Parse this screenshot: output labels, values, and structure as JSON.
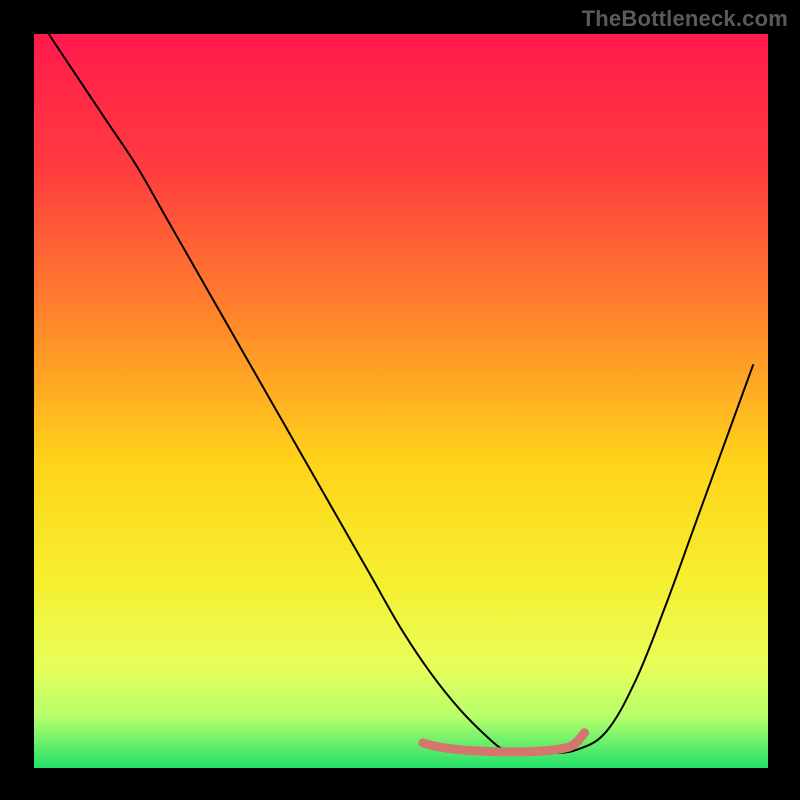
{
  "watermark": "TheBottleneck.com",
  "chart_data": {
    "type": "line",
    "title": "",
    "xlabel": "",
    "ylabel": "",
    "xlim": [
      0,
      100
    ],
    "ylim": [
      0,
      100
    ],
    "background_gradient": {
      "stops": [
        {
          "pos": 0.0,
          "color": "#ff1a4d"
        },
        {
          "pos": 0.18,
          "color": "#ff3b3f"
        },
        {
          "pos": 0.4,
          "color": "#ff8a2a"
        },
        {
          "pos": 0.58,
          "color": "#ffd21a"
        },
        {
          "pos": 0.74,
          "color": "#f6ef2e"
        },
        {
          "pos": 0.86,
          "color": "#e9fd5a"
        },
        {
          "pos": 0.93,
          "color": "#b6ff6a"
        },
        {
          "pos": 1.0,
          "color": "#22e06a"
        }
      ]
    },
    "series": [
      {
        "name": "bottleneck-curve",
        "color": "#000000",
        "width": 2,
        "x": [
          2,
          6,
          10,
          14,
          18,
          22,
          26,
          30,
          34,
          38,
          42,
          46,
          50,
          54,
          58,
          62,
          64,
          66,
          70,
          74,
          78,
          82,
          86,
          90,
          94,
          98
        ],
        "y": [
          100,
          94,
          88,
          82,
          75,
          68,
          61,
          54,
          47,
          40,
          33,
          26,
          19,
          13,
          8,
          4,
          2.5,
          2,
          2,
          2.5,
          5,
          12,
          22,
          33,
          44,
          55
        ]
      },
      {
        "name": "highlight-band",
        "color": "#d4756e",
        "width": 9,
        "linecap": "round",
        "x": [
          53,
          55,
          57,
          59,
          61,
          63,
          65,
          67,
          69,
          71,
          73,
          74,
          75
        ],
        "y": [
          3.4,
          2.9,
          2.6,
          2.4,
          2.3,
          2.2,
          2.2,
          2.2,
          2.3,
          2.5,
          2.9,
          3.6,
          4.8
        ]
      }
    ]
  }
}
